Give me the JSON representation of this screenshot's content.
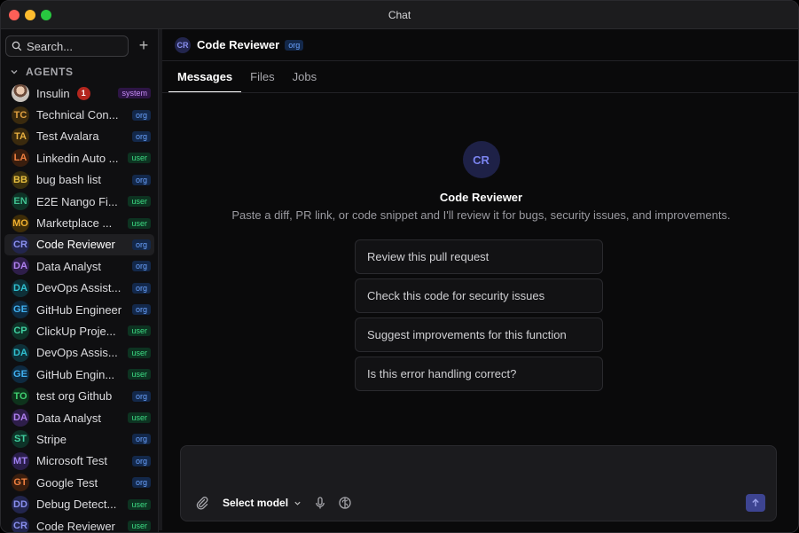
{
  "window": {
    "title": "Chat"
  },
  "sidebar": {
    "search_placeholder": "Search...",
    "section_label": "AGENTS",
    "agents": [
      {
        "initials": "",
        "name": "Insulin",
        "count": "1",
        "badge": "system",
        "photo": true
      },
      {
        "initials": "TC",
        "name": "Technical Con...",
        "badge": "org",
        "color": "#e0a040",
        "bg": "#3a2a0e"
      },
      {
        "initials": "TA",
        "name": "Test Avalara",
        "badge": "org",
        "color": "#e8b040",
        "bg": "#3a2a0e"
      },
      {
        "initials": "LA",
        "name": "Linkedin Auto ...",
        "badge": "user",
        "color": "#f08040",
        "bg": "#3a1e0e"
      },
      {
        "initials": "BB",
        "name": "bug bash list",
        "badge": "org",
        "color": "#e8c040",
        "bg": "#3a300e"
      },
      {
        "initials": "EN",
        "name": "E2E Nango Fi...",
        "badge": "user",
        "color": "#40c090",
        "bg": "#0e3326"
      },
      {
        "initials": "MO",
        "name": "Marketplace ...",
        "badge": "user",
        "color": "#f0b030",
        "bg": "#3d2c08"
      },
      {
        "initials": "CR",
        "name": "Code Reviewer",
        "badge": "org",
        "color": "#8a90f0",
        "bg": "#22254d",
        "selected": true
      },
      {
        "initials": "DA",
        "name": "Data Analyst",
        "badge": "org",
        "color": "#b080f0",
        "bg": "#2e1e4a"
      },
      {
        "initials": "DA",
        "name": "DevOps Assist...",
        "badge": "org",
        "color": "#30c0d0",
        "bg": "#0e3038"
      },
      {
        "initials": "GE",
        "name": "GitHub Engineer",
        "badge": "org",
        "color": "#40b0f0",
        "bg": "#0e2a40"
      },
      {
        "initials": "CP",
        "name": "ClickUp Proje...",
        "badge": "user",
        "color": "#40d0a0",
        "bg": "#0e3328"
      },
      {
        "initials": "DA",
        "name": "DevOps Assis...",
        "badge": "user",
        "color": "#30c0d0",
        "bg": "#0e3038"
      },
      {
        "initials": "GE",
        "name": "GitHub Engin...",
        "badge": "user",
        "color": "#40b0f0",
        "bg": "#0e2a40"
      },
      {
        "initials": "TO",
        "name": "test org Github",
        "badge": "org",
        "color": "#40d070",
        "bg": "#0e331c"
      },
      {
        "initials": "DA",
        "name": "Data Analyst",
        "badge": "user",
        "color": "#b080f0",
        "bg": "#2e1e4a"
      },
      {
        "initials": "ST",
        "name": "Stripe",
        "badge": "org",
        "color": "#40d0a0",
        "bg": "#0e3328"
      },
      {
        "initials": "MT",
        "name": "Microsoft Test",
        "badge": "org",
        "color": "#a080f0",
        "bg": "#2a1e4a"
      },
      {
        "initials": "GT",
        "name": "Google Test",
        "badge": "org",
        "color": "#f08040",
        "bg": "#3a1e0e"
      },
      {
        "initials": "DD",
        "name": "Debug Detect...",
        "badge": "user",
        "color": "#8a90f0",
        "bg": "#22254d"
      },
      {
        "initials": "CR",
        "name": "Code Reviewer",
        "badge": "user",
        "color": "#8a90f0",
        "bg": "#22254d"
      }
    ]
  },
  "header": {
    "initials": "CR",
    "title": "Code Reviewer",
    "badge": "org"
  },
  "tabs": [
    {
      "label": "Messages",
      "active": true
    },
    {
      "label": "Files",
      "active": false
    },
    {
      "label": "Jobs",
      "active": false
    }
  ],
  "welcome": {
    "initials": "CR",
    "title": "Code Reviewer",
    "description": "Paste a diff, PR link, or code snippet and I'll review it for bugs, security issues, and improvements."
  },
  "suggestions": [
    "Review this pull request",
    "Check this code for security issues",
    "Suggest improvements for this function",
    "Is this error handling correct?"
  ],
  "composer": {
    "model_label": "Select model",
    "value": ""
  },
  "icons": {
    "search": "search-icon",
    "plus": "plus-icon",
    "chevron": "chevron-down-icon",
    "attach": "paperclip-icon",
    "mic": "microphone-icon",
    "tools": "brain-icon",
    "send": "arrow-up-icon"
  }
}
